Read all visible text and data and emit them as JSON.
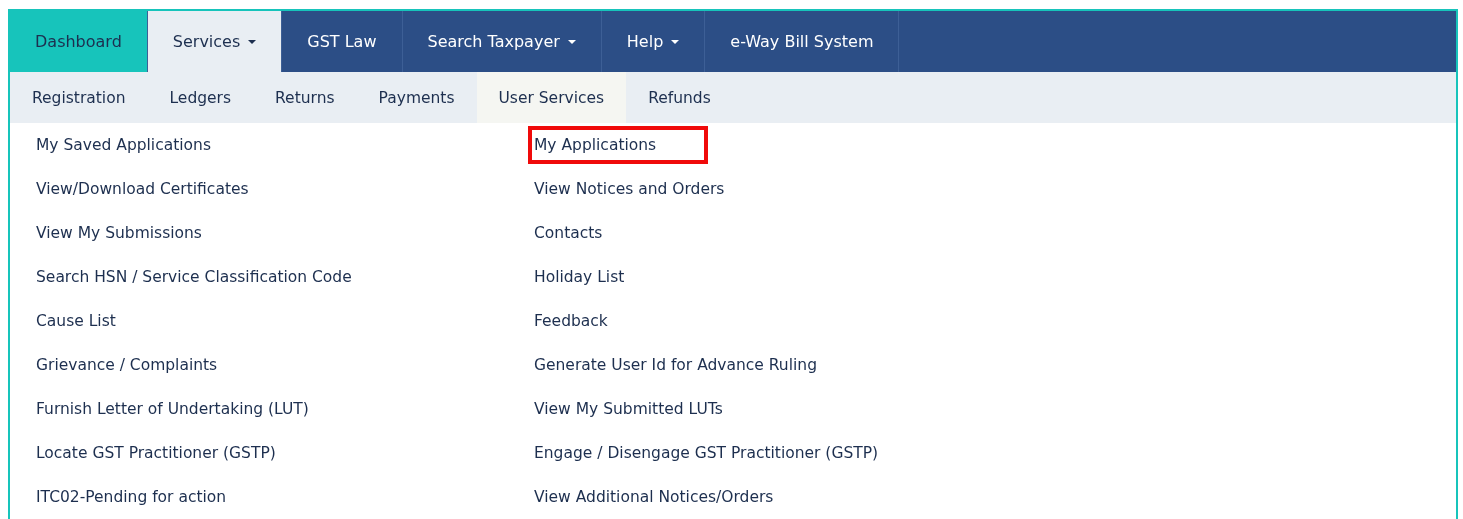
{
  "top_nav": [
    {
      "label": "Dashboard",
      "active": true,
      "open": false,
      "dropdown": false
    },
    {
      "label": "Services",
      "active": false,
      "open": true,
      "dropdown": true
    },
    {
      "label": "GST Law",
      "active": false,
      "open": false,
      "dropdown": false
    },
    {
      "label": "Search Taxpayer",
      "active": false,
      "open": false,
      "dropdown": true
    },
    {
      "label": "Help",
      "active": false,
      "open": false,
      "dropdown": true
    },
    {
      "label": "e-Way Bill System",
      "active": false,
      "open": false,
      "dropdown": false
    }
  ],
  "sub_nav": [
    {
      "label": "Registration",
      "selected": false
    },
    {
      "label": "Ledgers",
      "selected": false
    },
    {
      "label": "Returns",
      "selected": false
    },
    {
      "label": "Payments",
      "selected": false
    },
    {
      "label": "User Services",
      "selected": true
    },
    {
      "label": "Refunds",
      "selected": false
    }
  ],
  "menu_columns": [
    [
      {
        "label": "My Saved Applications",
        "highlighted": false
      },
      {
        "label": "View/Download Certificates",
        "highlighted": false
      },
      {
        "label": "View My Submissions",
        "highlighted": false
      },
      {
        "label": "Search HSN / Service Classification Code",
        "highlighted": false
      },
      {
        "label": "Cause List",
        "highlighted": false
      },
      {
        "label": "Grievance / Complaints",
        "highlighted": false
      },
      {
        "label": "Furnish Letter of Undertaking (LUT)",
        "highlighted": false
      },
      {
        "label": "Locate GST Practitioner (GSTP)",
        "highlighted": false
      },
      {
        "label": "ITC02-Pending for action",
        "highlighted": false
      }
    ],
    [
      {
        "label": "My Applications",
        "highlighted": true
      },
      {
        "label": "View Notices and Orders",
        "highlighted": false
      },
      {
        "label": "Contacts",
        "highlighted": false
      },
      {
        "label": "Holiday List",
        "highlighted": false
      },
      {
        "label": "Feedback",
        "highlighted": false
      },
      {
        "label": "Generate User Id for Advance Ruling",
        "highlighted": false
      },
      {
        "label": "View My Submitted LUTs",
        "highlighted": false
      },
      {
        "label": "Engage / Disengage GST Practitioner (GSTP)",
        "highlighted": false
      },
      {
        "label": "View Additional Notices/Orders",
        "highlighted": false
      }
    ]
  ]
}
